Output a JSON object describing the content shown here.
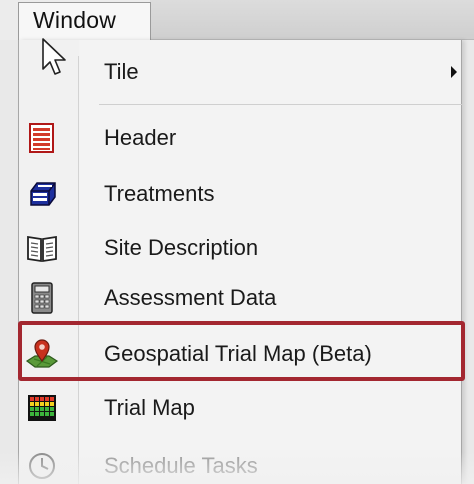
{
  "menubar": {
    "window_label": "Window"
  },
  "menu": {
    "items": [
      {
        "label": "Tile",
        "icon": "none",
        "has_submenu": true
      },
      {
        "label": "Header",
        "icon": "header-list-icon"
      },
      {
        "label": "Treatments",
        "icon": "treatments-database-icon"
      },
      {
        "label": "Site Description",
        "icon": "open-book-icon"
      },
      {
        "label": "Assessment Data",
        "icon": "calculator-icon"
      },
      {
        "label": "Geospatial Trial Map (Beta)",
        "icon": "map-pin-icon",
        "highlighted": true
      },
      {
        "label": "Trial Map",
        "icon": "grid-map-icon"
      },
      {
        "label": "Schedule Tasks",
        "icon": "clock-icon",
        "partially_visible": true
      }
    ]
  },
  "colors": {
    "highlight_border": "#a32730",
    "menu_background": "#f3f3f3"
  }
}
